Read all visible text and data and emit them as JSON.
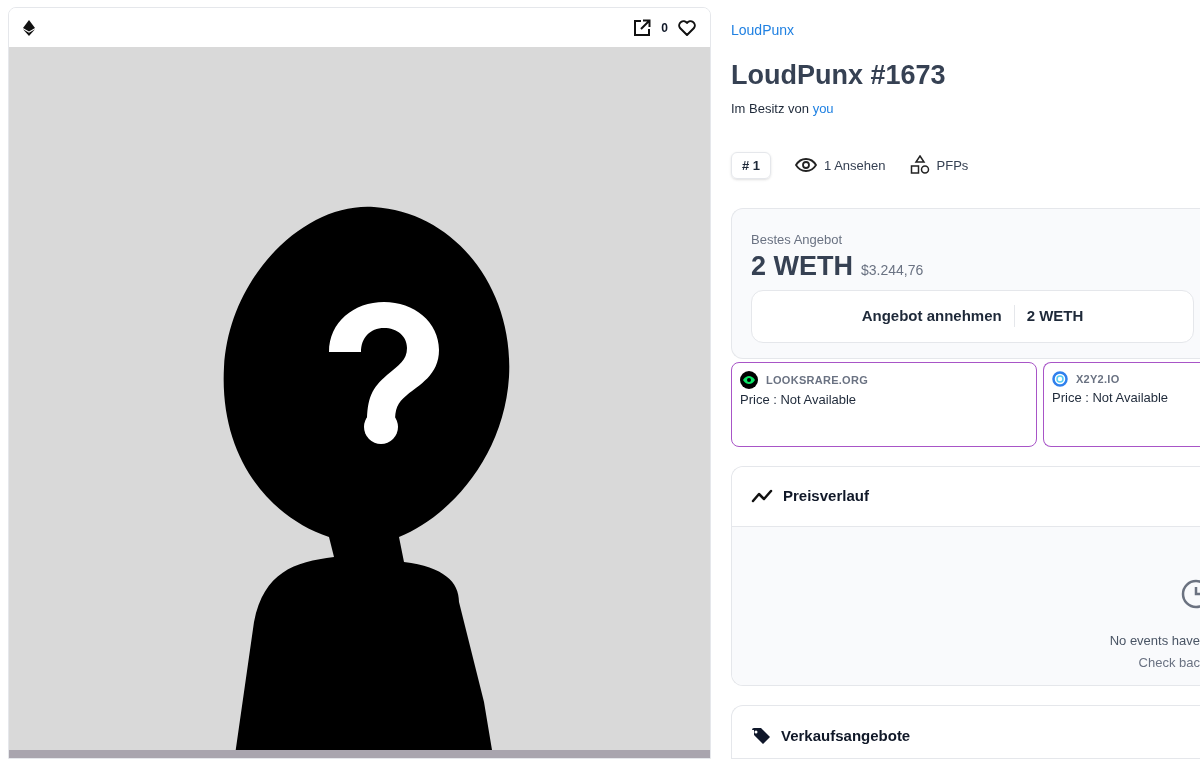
{
  "media": {
    "likes": "0",
    "kind": "picture"
  },
  "collection": "LoudPunx",
  "title": "LoudPunx #1673",
  "owner": {
    "label": "Im Besitz von",
    "name": "you"
  },
  "meta": [
    {
      "kind": "rank",
      "label": "# 1"
    },
    {
      "kind": "views",
      "label": "1 Ansehen"
    },
    {
      "kind": "category",
      "label": "PFPs"
    }
  ],
  "best_offer": {
    "label": "Bestes Angebot",
    "amount": "2 WETH",
    "fiat": "$3.244,76",
    "button": {
      "label": "Angebot annehmen",
      "amount": "2 WETH"
    }
  },
  "markets": [
    {
      "name": "LOOKSRARE.ORG",
      "price": "Price : Not Available",
      "kind": "looksrare"
    },
    {
      "name": "X2Y2.IO",
      "price": "Price : Not Available",
      "kind": "x2y2"
    }
  ],
  "price_history": {
    "title": "Preisverlauf",
    "empty_title": "No events have",
    "empty_hint": "Check bac"
  },
  "listings": {
    "title": "Verkaufsangebote"
  }
}
